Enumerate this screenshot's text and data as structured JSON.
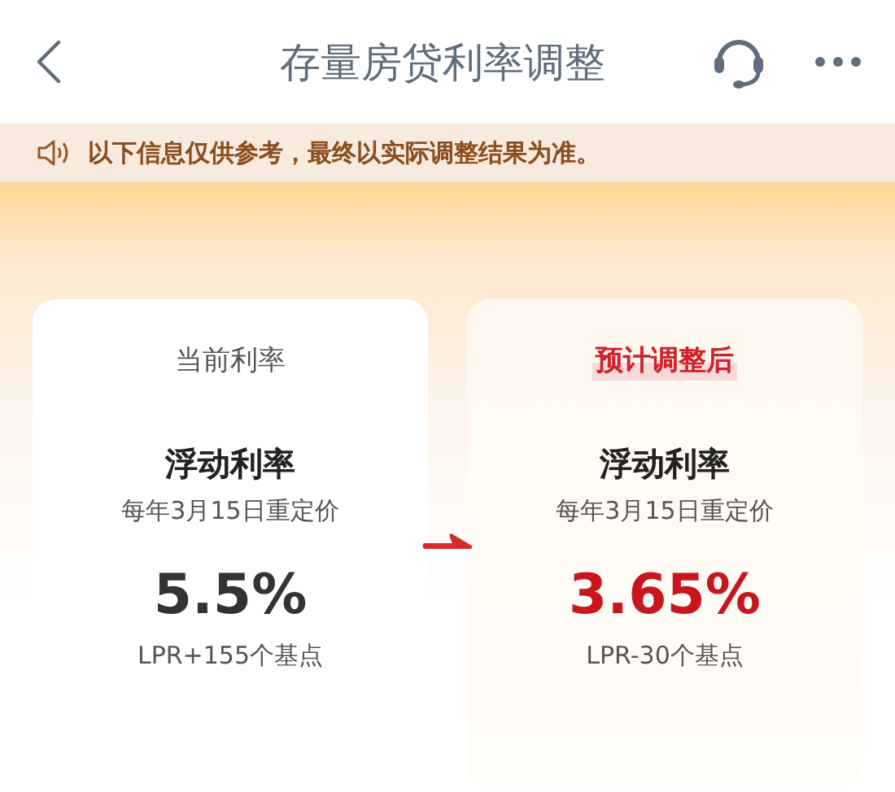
{
  "header": {
    "title": "存量房贷利率调整"
  },
  "notice": {
    "text": "以下信息仅供参考，最终以实际调整结果为准。"
  },
  "cards": [
    {
      "kind": "current",
      "heading": "当前利率",
      "type": "浮动利率",
      "reprice": "每年3月15日重定价",
      "rate": "5.5%",
      "basis": "LPR+155个基点"
    },
    {
      "kind": "projected",
      "heading": "预计调整后",
      "type": "浮动利率",
      "reprice": "每年3月15日重定价",
      "rate": "3.65%",
      "basis": "LPR-30个基点"
    }
  ]
}
